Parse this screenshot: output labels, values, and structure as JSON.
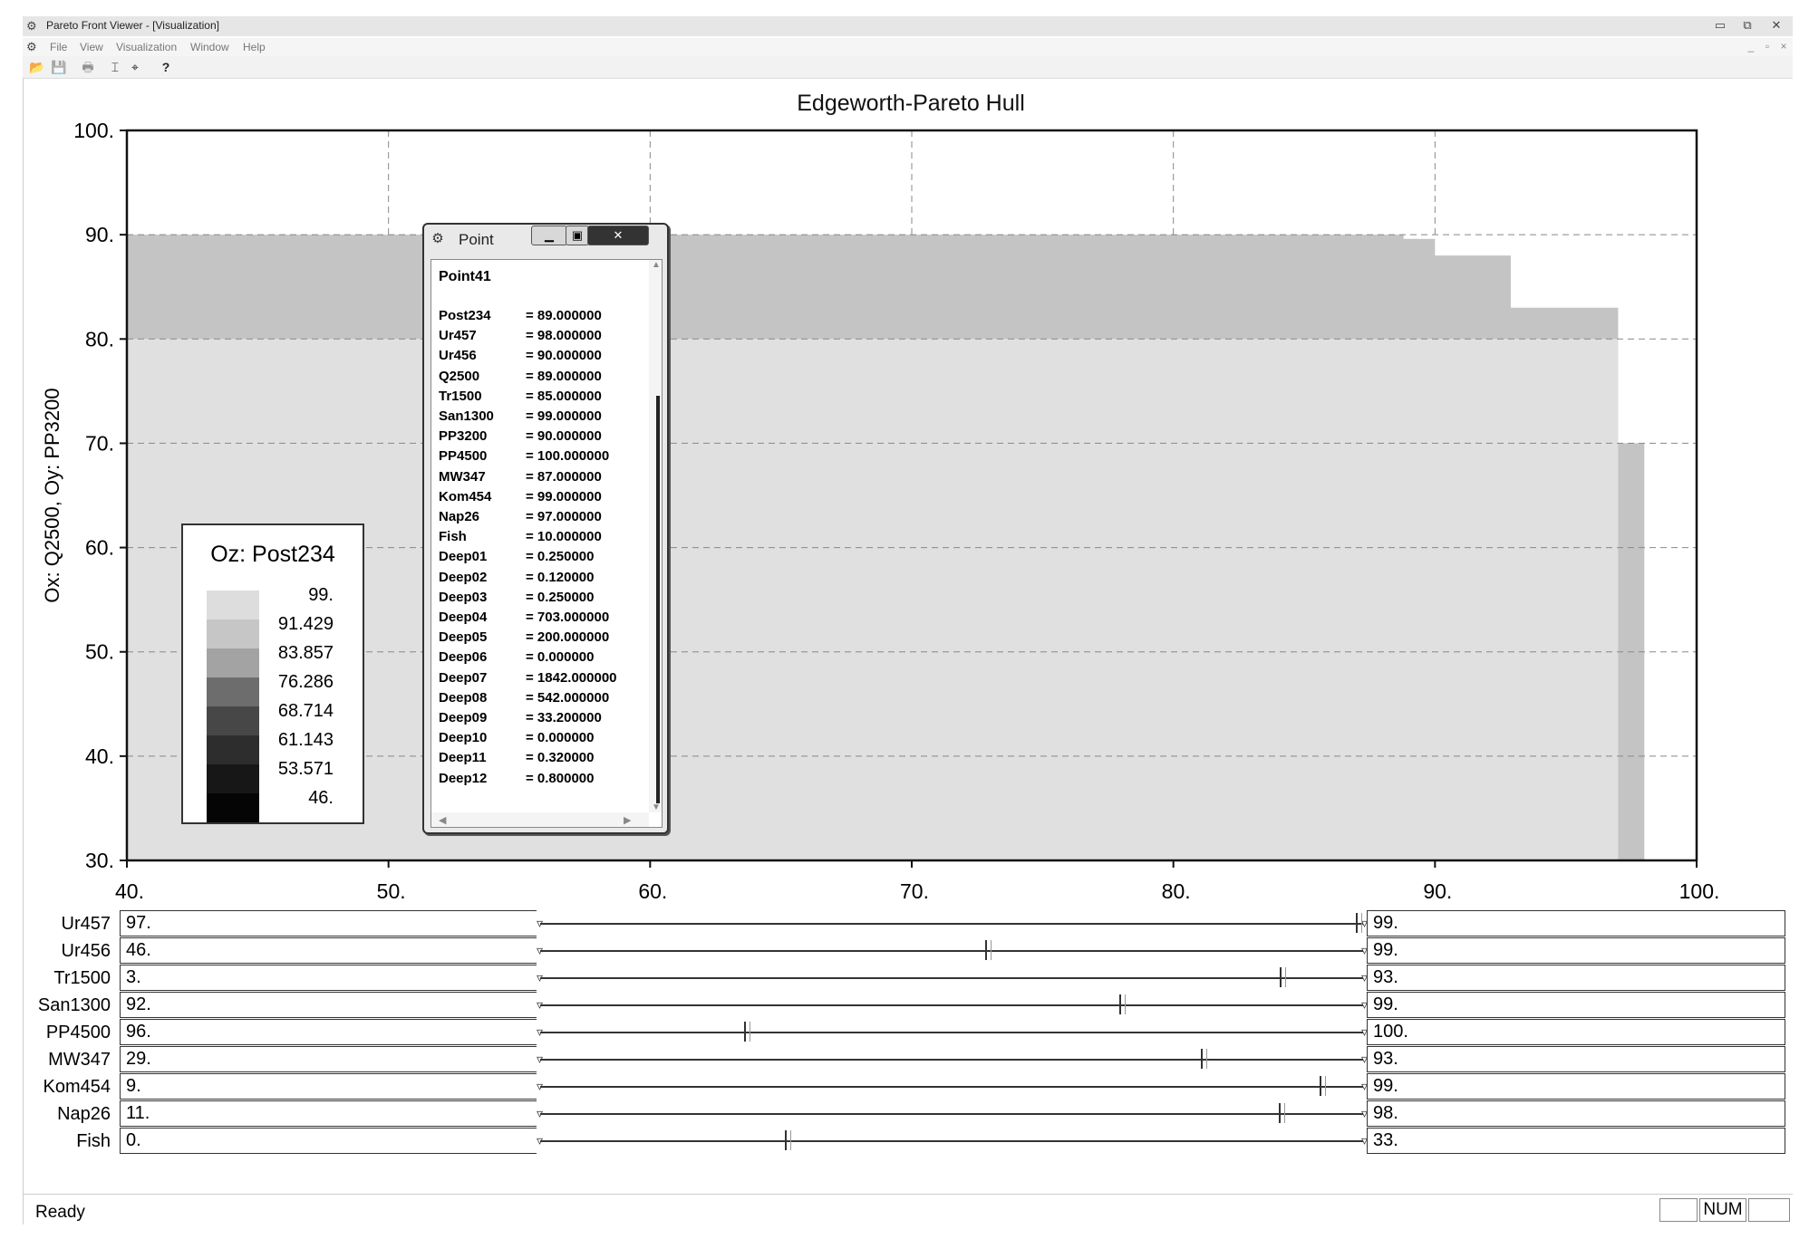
{
  "window": {
    "title": "Pareto Front Viewer - [Visualization]",
    "app_icon": "pareto-app-icon",
    "caption_buttons": [
      "▭",
      "⧉",
      "✕"
    ],
    "mdi_buttons": [
      "_",
      "▫",
      "×"
    ]
  },
  "menubar": {
    "items": [
      "File",
      "View",
      "Visualization",
      "Window",
      "Help"
    ]
  },
  "toolbar": {
    "buttons": [
      {
        "icon": "open-folder-icon",
        "glyph": "📂"
      },
      {
        "icon": "save-disk-icon",
        "glyph": "💾"
      },
      {
        "icon": "print-icon",
        "glyph": "🖶"
      },
      {
        "icon": "axis-settings-icon",
        "glyph": "⌶"
      },
      {
        "icon": "point-pick-icon",
        "glyph": "⌖"
      },
      {
        "icon": "help-icon",
        "glyph": "?"
      }
    ]
  },
  "chart_data": {
    "type": "area",
    "title": "Edgeworth-Pareto Hull",
    "ylabel": "Ox: Q2500, Oy: PP3200",
    "xlabel": "",
    "xlim": [
      40,
      100
    ],
    "ylim": [
      30,
      100
    ],
    "x_ticks": [
      "40.",
      "50.",
      "60.",
      "70.",
      "80.",
      "90.",
      "100."
    ],
    "y_ticks": [
      "30.",
      "40.",
      "50.",
      "60.",
      "70.",
      "80.",
      "90.",
      "100."
    ],
    "grid": true,
    "grid_style": "dashed",
    "regions": [
      {
        "z_level": 99,
        "fill": "#e0e0e0",
        "steps": [
          [
            40,
            80
          ],
          [
            97,
            80
          ],
          [
            97,
            70
          ],
          [
            98,
            70
          ],
          [
            98,
            30
          ]
        ]
      },
      {
        "z_level": 91.429,
        "fill": "#c4c4c4",
        "steps": [
          [
            40,
            90
          ],
          [
            88.8,
            90
          ],
          [
            88.8,
            89.6
          ],
          [
            90,
            89.6
          ],
          [
            90,
            88.0
          ],
          [
            92.9,
            88.0
          ],
          [
            92.9,
            83.0
          ],
          [
            97,
            83.0
          ],
          [
            97,
            80
          ],
          [
            40,
            80
          ]
        ]
      },
      {
        "z_level": 91.429,
        "fill": "#c4c4c4",
        "steps": [
          [
            97,
            70
          ],
          [
            98,
            70
          ],
          [
            98,
            30
          ],
          [
            97,
            30
          ]
        ]
      }
    ],
    "legend": {
      "title": "Oz: Post234",
      "placement": "lower-left",
      "levels": [
        "99.",
        "91.429",
        "83.857",
        "76.286",
        "68.714",
        "61.143",
        "53.571",
        "46."
      ],
      "colors": [
        "#dddddd",
        "#c6c6c6",
        "#a3a3a3",
        "#6d6d6d",
        "#474747",
        "#2d2d2d",
        "#171717",
        "#050505"
      ]
    }
  },
  "point_dialog": {
    "title": "Point",
    "heading": "Point41",
    "rows": [
      {
        "name": "Post234",
        "value": "= 89.000000"
      },
      {
        "name": "Ur457",
        "value": "= 98.000000"
      },
      {
        "name": "Ur456",
        "value": "= 90.000000"
      },
      {
        "name": "Q2500",
        "value": "= 89.000000"
      },
      {
        "name": "Tr1500",
        "value": "= 85.000000"
      },
      {
        "name": "San1300",
        "value": "= 99.000000"
      },
      {
        "name": "PP3200",
        "value": "= 90.000000"
      },
      {
        "name": "PP4500",
        "value": "= 100.000000"
      },
      {
        "name": "MW347",
        "value": "= 87.000000"
      },
      {
        "name": "Kom454",
        "value": "= 99.000000"
      },
      {
        "name": "Nap26",
        "value": "= 97.000000"
      },
      {
        "name": "Fish",
        "value": "= 10.000000"
      },
      {
        "name": "Deep01",
        "value": "= 0.250000"
      },
      {
        "name": "Deep02",
        "value": "= 0.120000"
      },
      {
        "name": "Deep03",
        "value": "= 0.250000"
      },
      {
        "name": "Deep04",
        "value": "= 703.000000"
      },
      {
        "name": "Deep05",
        "value": "= 200.000000"
      },
      {
        "name": "Deep06",
        "value": "= 0.000000"
      },
      {
        "name": "Deep07",
        "value": "= 1842.000000"
      },
      {
        "name": "Deep08",
        "value": "= 542.000000"
      },
      {
        "name": "Deep09",
        "value": "= 33.200000"
      },
      {
        "name": "Deep10",
        "value": "= 0.000000"
      },
      {
        "name": "Deep11",
        "value": "= 0.320000"
      },
      {
        "name": "Deep12",
        "value": "= 0.800000"
      }
    ]
  },
  "sliders": [
    {
      "name": "Ur457",
      "min": "97.",
      "max": "99.",
      "position": 1.0
    },
    {
      "name": "Ur456",
      "min": "46.",
      "max": "99.",
      "position": 0.545
    },
    {
      "name": "Tr1500",
      "min": "3.",
      "max": "93.",
      "position": 0.907
    },
    {
      "name": "San1300",
      "min": "92.",
      "max": "99.",
      "position": 0.71
    },
    {
      "name": "PP4500",
      "min": "96.",
      "max": "100.",
      "position": 0.25
    },
    {
      "name": "MW347",
      "min": "29.",
      "max": "93.",
      "position": 0.81
    },
    {
      "name": "Kom454",
      "min": "9.",
      "max": "99.",
      "position": 0.955
    },
    {
      "name": "Nap26",
      "min": "11.",
      "max": "98.",
      "position": 0.905
    },
    {
      "name": "Fish",
      "min": "0.",
      "max": "33.",
      "position": 0.3
    }
  ],
  "status": {
    "text": "Ready",
    "panels": [
      "",
      "NUM",
      ""
    ]
  }
}
